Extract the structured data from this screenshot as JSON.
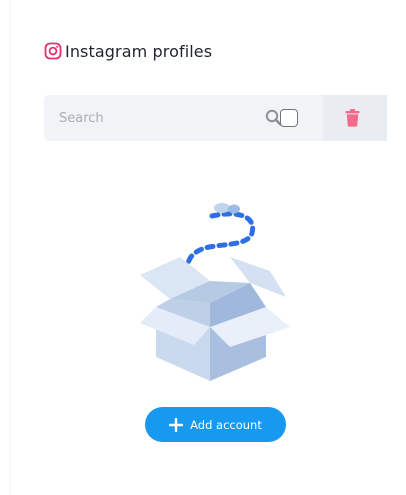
{
  "header": {
    "title": "Instagram profiles",
    "icon": "instagram-icon"
  },
  "toolbar": {
    "search_placeholder": "Search",
    "search_value": "",
    "search_icon": "search-icon",
    "select_all_checked": false,
    "delete_icon": "trash-icon"
  },
  "empty_state": {
    "illustration": "empty-box-illustration"
  },
  "actions": {
    "add_account_label": "Add account",
    "add_icon": "plus-icon"
  },
  "colors": {
    "accent": "#1799ef",
    "instagram": "#e1306c",
    "delete": "#f06c8a",
    "toolbar_bg": "#f1f3f6"
  }
}
